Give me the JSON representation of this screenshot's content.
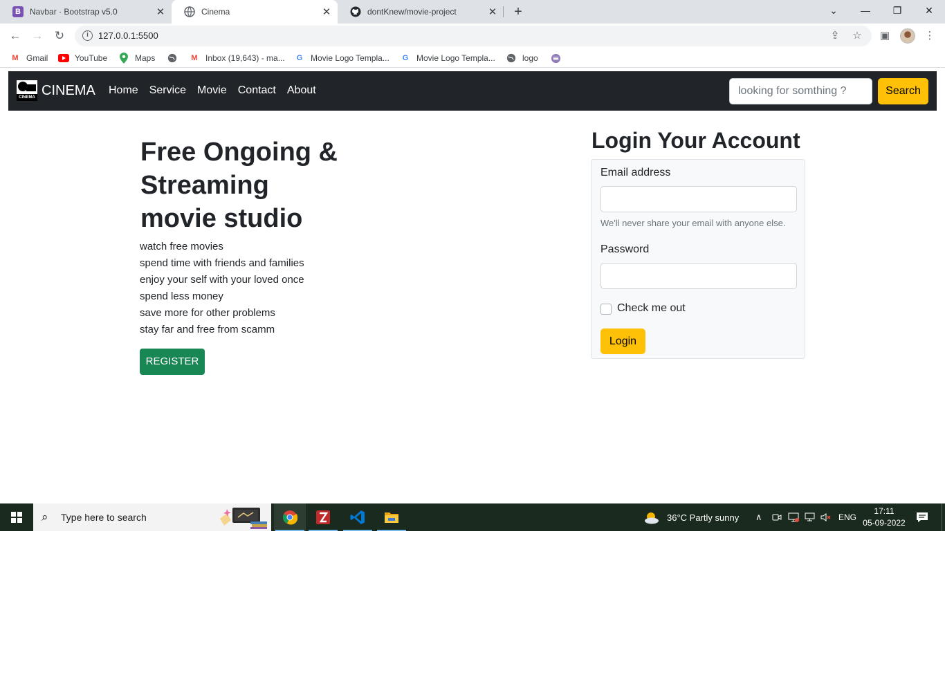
{
  "browser": {
    "tabs": [
      {
        "title": "Navbar · Bootstrap v5.0",
        "icon": "bootstrap-icon",
        "active": false
      },
      {
        "title": "Cinema",
        "icon": "globe-icon",
        "active": true
      },
      {
        "title": "dontKnew/movie-project",
        "icon": "github-icon",
        "active": false
      }
    ],
    "url": "127.0.0.1:5500",
    "bookmarks": [
      {
        "label": "Gmail",
        "icon": "gmail-icon"
      },
      {
        "label": "YouTube",
        "icon": "youtube-icon"
      },
      {
        "label": "Maps",
        "icon": "maps-icon"
      },
      {
        "label": "",
        "icon": "globe-icon"
      },
      {
        "label": "Inbox (19,643) - ma...",
        "icon": "gmail-icon"
      },
      {
        "label": "Movie Logo Templa...",
        "icon": "google-icon"
      },
      {
        "label": "Movie Logo Templa...",
        "icon": "google-icon"
      },
      {
        "label": "logo",
        "icon": "globe-icon"
      },
      {
        "label": "",
        "icon": "menu-circle-icon"
      }
    ]
  },
  "navbar": {
    "brand": "CINEMA",
    "logo_caption": "CINEMA",
    "links": [
      "Home",
      "Service",
      "Movie",
      "Contact",
      "About"
    ],
    "search_placeholder": "looking for somthing ?",
    "search_button": "Search",
    "background": "#212529",
    "accent": "#ffc107"
  },
  "hero": {
    "title_lines": [
      "Free Ongoing &",
      "Streaming",
      "movie studio"
    ],
    "items": [
      "watch free movies",
      "spend time with friends and families",
      "enjoy your self with your loved once",
      "spend less money",
      "save more for other problems",
      "stay far and free from scamm"
    ],
    "register_button": "REGISTER",
    "register_color": "#198754"
  },
  "login": {
    "heading": "Login Your Account",
    "email_label": "Email address",
    "email_value": "",
    "email_help": "We'll never share your email with anyone else.",
    "password_label": "Password",
    "password_value": "",
    "checkbox_label": "Check me out",
    "checkbox_checked": false,
    "submit_button": "Login"
  },
  "taskbar": {
    "search_placeholder": "Type here to search",
    "apps": [
      "chrome-icon",
      "filezilla-icon",
      "vscode-icon",
      "file-explorer-icon"
    ],
    "weather": "36°C  Partly sunny",
    "language": "ENG",
    "time": "17:11",
    "date": "05-09-2022"
  }
}
